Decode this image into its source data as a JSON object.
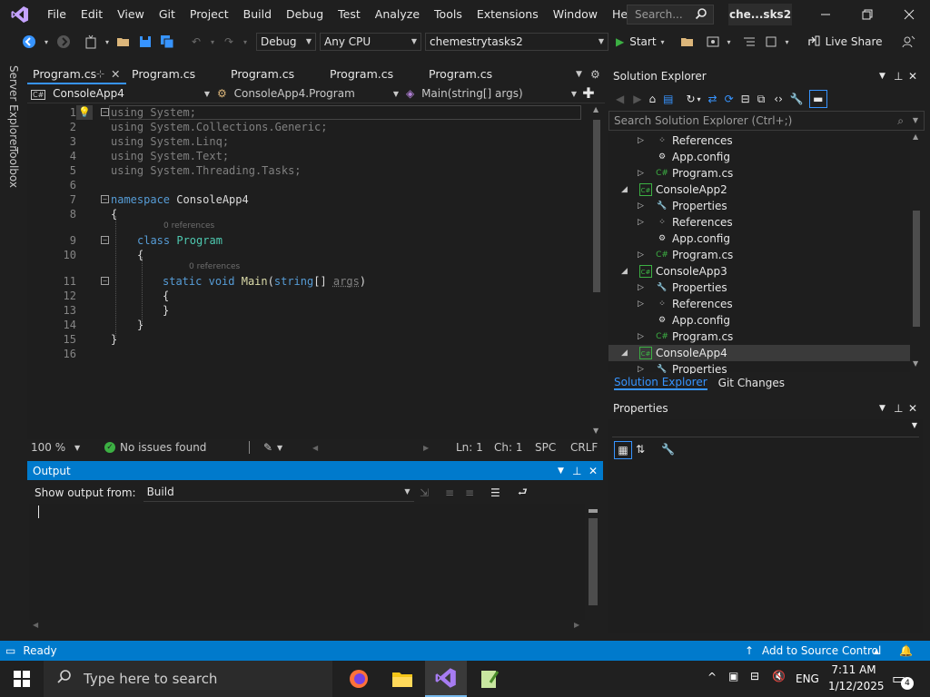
{
  "menu": [
    "File",
    "Edit",
    "View",
    "Git",
    "Project",
    "Build",
    "Debug",
    "Test",
    "Analyze",
    "Tools",
    "Extensions",
    "Window",
    "Help"
  ],
  "search": {
    "placeholder": "Search..."
  },
  "solution_title": "che...sks2",
  "toolbar": {
    "config": "Debug",
    "platform": "Any CPU",
    "startup_project": "chemestrytasks2",
    "start_label": "Start",
    "live_share": "Live Share"
  },
  "side_tabs": [
    "Server Explorer",
    "Toolbox"
  ],
  "editor_tabs": [
    "Program.cs",
    "Program.cs",
    "Program.cs",
    "Program.cs",
    "Program.cs"
  ],
  "nav": {
    "project": "ConsoleApp4",
    "class": "ConsoleApp4.Program",
    "member": "Main(string[] args)"
  },
  "code": {
    "line_numbers": [
      "1",
      "2",
      "3",
      "4",
      "5",
      "6",
      "7",
      "8",
      "9",
      "10",
      "11",
      "12",
      "13",
      "14",
      "15",
      "16"
    ],
    "l1_kw": "using",
    "l1_rest": " System;",
    "l2_kw": "using",
    "l2_rest": " System.Collections.Generic;",
    "l3_kw": "using",
    "l3_rest": " System.Linq;",
    "l4_kw": "using",
    "l4_rest": " System.Text;",
    "l5_kw": "using",
    "l5_rest": " System.Threading.Tasks;",
    "l7_kw": "namespace",
    "l7_rest": " ConsoleApp4",
    "brace_open": "{",
    "brace_close": "}",
    "codelens": "0 references",
    "l9_kw": "class",
    "l9_type": "Program",
    "l11_kw1": "static",
    "l11_kw2": "void",
    "l11_fn": "Main",
    "l11_p1": "(",
    "l11_kw3": "string",
    "l11_p2": "[] ",
    "l11_arg": "args",
    "l11_p3": ")"
  },
  "editor_status": {
    "zoom": "100 %",
    "issues": "No issues found",
    "ln": "Ln: 1",
    "ch": "Ch: 1",
    "spc": "SPC",
    "crlf": "CRLF"
  },
  "output": {
    "title": "Output",
    "show_from_label": "Show output from:",
    "source": "Build"
  },
  "solution_explorer": {
    "title": "Solution Explorer",
    "search_placeholder": "Search Solution Explorer (Ctrl+;)",
    "items": [
      {
        "label": "References",
        "icon": "references-icon",
        "level": 2,
        "expand": "collapsed"
      },
      {
        "label": "App.config",
        "icon": "config-icon",
        "level": 2,
        "expand": "none"
      },
      {
        "label": "Program.cs",
        "icon": "csharp-file-icon",
        "level": 2,
        "expand": "collapsed"
      },
      {
        "label": "ConsoleApp2",
        "icon": "csharp-project-icon",
        "level": 1,
        "expand": "expanded"
      },
      {
        "label": "Properties",
        "icon": "wrench-icon",
        "level": 2,
        "expand": "collapsed"
      },
      {
        "label": "References",
        "icon": "references-icon",
        "level": 2,
        "expand": "collapsed"
      },
      {
        "label": "App.config",
        "icon": "config-icon",
        "level": 2,
        "expand": "none"
      },
      {
        "label": "Program.cs",
        "icon": "csharp-file-icon",
        "level": 2,
        "expand": "collapsed"
      },
      {
        "label": "ConsoleApp3",
        "icon": "csharp-project-icon",
        "level": 1,
        "expand": "expanded"
      },
      {
        "label": "Properties",
        "icon": "wrench-icon",
        "level": 2,
        "expand": "collapsed"
      },
      {
        "label": "References",
        "icon": "references-icon",
        "level": 2,
        "expand": "collapsed"
      },
      {
        "label": "App.config",
        "icon": "config-icon",
        "level": 2,
        "expand": "none"
      },
      {
        "label": "Program.cs",
        "icon": "csharp-file-icon",
        "level": 2,
        "expand": "collapsed"
      },
      {
        "label": "ConsoleApp4",
        "icon": "csharp-project-icon",
        "level": 1,
        "expand": "expanded"
      },
      {
        "label": "Properties",
        "icon": "wrench-icon",
        "level": 2,
        "expand": "collapsed"
      }
    ],
    "tabs": [
      "Solution Explorer",
      "Git Changes"
    ]
  },
  "properties": {
    "title": "Properties"
  },
  "status": {
    "ready": "Ready",
    "source_control": "Add to Source Control",
    "notifications": "4"
  },
  "taskbar": {
    "search_placeholder": "Type here to search",
    "lang": "ENG",
    "time": "7:11 AM",
    "date": "1/12/2025"
  },
  "colors": {
    "accent": "#007acc",
    "keyword": "#569cd6",
    "type": "#4ec9b0",
    "method": "#dcdcaa",
    "linenum": "#858585"
  }
}
